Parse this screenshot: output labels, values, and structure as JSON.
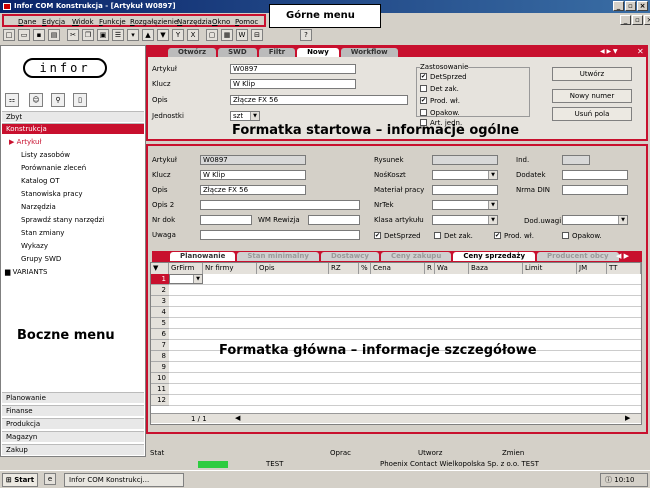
{
  "window": {
    "title": "Infor COM Konstrukcja - [Artykuł W0897]",
    "controls": [
      "_",
      "▫",
      "×"
    ]
  },
  "menu": {
    "items": [
      "Dane",
      "Edycja",
      "Widok",
      "Funkcje",
      "Rozgałęzienie",
      "Narzędzia",
      "Okno",
      "Pomoc"
    ]
  },
  "callout": {
    "text": "Górne menu"
  },
  "sidebar": {
    "logo": "infor",
    "top_section": "Zbyt",
    "active_section": "Konstrukcja",
    "items": [
      "Artykuł",
      "Listy zasobów",
      "Porównanie zleceń",
      "Katalog OT",
      "Stanowiska pracy",
      "Narzędzia",
      "Sprawdź stany narzędzi",
      "Stan zmiany",
      "Wykazy",
      "Grupy SWD",
      "VARIANTS"
    ],
    "overlay": "Boczne menu",
    "bottom_sections": [
      "Planowanie",
      "Finanse",
      "Produkcja",
      "Magazyn",
      "Zakup"
    ]
  },
  "start_form": {
    "tabs": [
      "Otwórz",
      "SWD",
      "Filtr",
      "Nowy",
      "Workflow"
    ],
    "labels": {
      "artykul": "Artykuł",
      "klucz": "Klucz",
      "opis": "Opis",
      "jednostki": "Jednostki"
    },
    "values": {
      "artykul": "W0897",
      "klucz": "W Klip",
      "opis": "Złącze FX 56",
      "jednostki": "szt"
    },
    "usage_group": "Zastosowanie",
    "usage": [
      {
        "label": "DetSprzed",
        "checked": true
      },
      {
        "label": "Det zak.",
        "checked": false
      },
      {
        "label": "Prod. wł.",
        "checked": true
      },
      {
        "label": "Opakow.",
        "checked": false
      },
      {
        "label": "Art. jedn.",
        "checked": false
      }
    ],
    "buttons": [
      "Utwórz",
      "Nowy numer",
      "Usuń pola"
    ],
    "overlay": "Formatka startowa – informacje ogólne"
  },
  "main_form": {
    "labels": {
      "artykul": "Artykuł",
      "klucz": "Klucz",
      "opis": "Opis",
      "opis2": "Opis 2",
      "nrdok": "Nr dok",
      "wm": "WM Rewizja",
      "uwaga": "Uwaga",
      "rysunek": "Rysunek",
      "noskoszt": "NośKoszt",
      "material": "Materiał pracy",
      "nrtek": "NrTek",
      "klasa": "Klasa artykułu",
      "ind": "Ind.",
      "dodatek": "Dodatek",
      "nrmadin": "Nrma DIN",
      "doduwagi": "Dod.uwagi"
    },
    "values": {
      "artykul": "W0897",
      "klucz": "W Klip",
      "opis": "Złącze FX 56"
    },
    "checks": [
      {
        "label": "DetSprzed",
        "checked": true
      },
      {
        "label": "Det zak.",
        "checked": false
      },
      {
        "label": "Prod. wł.",
        "checked": true
      },
      {
        "label": "Opakow.",
        "checked": false
      }
    ],
    "tabs": [
      "Planowanie",
      "Stan minimalny",
      "Dostawcy",
      "Ceny zakupu",
      "Ceny sprzedaży",
      "Producent obcy"
    ],
    "grid_columns": [
      "GrFirm",
      "Nr firmy",
      "Opis",
      "RZ",
      "%",
      "Cena",
      "R",
      "Wa",
      "Baza",
      "Limit",
      "JM",
      "TT"
    ],
    "rows": [
      "1",
      "2",
      "3",
      "4",
      "5",
      "6",
      "7",
      "8",
      "9",
      "10",
      "11",
      "12"
    ],
    "pager": "1 / 1",
    "overlay": "Formatka główna – informacje szczegółowe"
  },
  "status": {
    "labels": [
      "Stat",
      "Oprac",
      "Utworz",
      "Zmien"
    ],
    "env": "TEST",
    "company": "Phoenix Contact Wielkopolska Sp. z o.o. TEST"
  },
  "taskbar": {
    "start": "Start",
    "task": "Infor COM Konstrukcj...",
    "clock": "10:10"
  }
}
